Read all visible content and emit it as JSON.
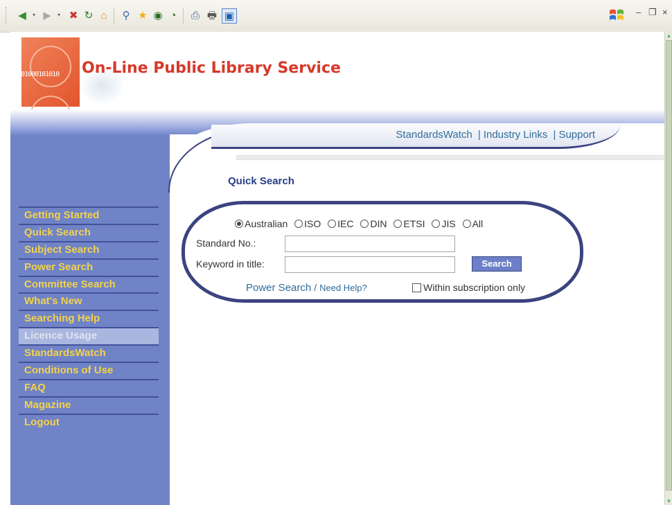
{
  "browser": {
    "toolbar_icons": [
      "back-icon",
      "back-dropdown-icon",
      "forward-icon",
      "forward-dropdown-icon",
      "stop-icon",
      "refresh-icon",
      "home-icon",
      "search-icon",
      "favorites-icon",
      "media-icon",
      "history-icon",
      "print-preview-icon",
      "print-icon",
      "window-icon"
    ]
  },
  "site": {
    "logo_bits": "01000101010",
    "title": "On-Line Public Library Service"
  },
  "top_nav": {
    "items": [
      "StandardsWatch",
      "Industry Links",
      "Support"
    ],
    "separator": "|"
  },
  "quick_search": {
    "heading": "Quick Search",
    "options": [
      {
        "label": "Australian",
        "selected": true
      },
      {
        "label": "ISO",
        "selected": false
      },
      {
        "label": "IEC",
        "selected": false
      },
      {
        "label": "DIN",
        "selected": false
      },
      {
        "label": "ETSI",
        "selected": false
      },
      {
        "label": "JIS",
        "selected": false
      },
      {
        "label": "All",
        "selected": false
      }
    ],
    "standard_no_label": "Standard No.:",
    "standard_no_value": "",
    "keyword_label": "Keyword in title:",
    "keyword_value": "",
    "search_button": "Search",
    "power_search_link": "Power Search",
    "slash": "/",
    "need_help_link": "Need Help?",
    "subscription_checkbox_label": "Within subscription only",
    "subscription_checked": false
  },
  "sidebar": {
    "items": [
      {
        "label": "Getting Started",
        "active": false
      },
      {
        "label": "Quick Search",
        "active": false
      },
      {
        "label": "Subject Search",
        "active": false
      },
      {
        "label": "Power Search",
        "active": false
      },
      {
        "label": "Committee Search",
        "active": false
      },
      {
        "label": "What's New",
        "active": false
      },
      {
        "label": "Searching Help",
        "active": false
      },
      {
        "label": "Licence Usage",
        "active": true
      },
      {
        "label": "StandardsWatch",
        "active": false
      },
      {
        "label": "Conditions of Use",
        "active": false
      },
      {
        "label": "FAQ",
        "active": false
      },
      {
        "label": "Magazine",
        "active": false
      },
      {
        "label": "Logout",
        "active": false
      }
    ]
  },
  "colors": {
    "title_red": "#d8382a",
    "sidebar_blue": "#6f83c6",
    "menu_yellow": "#f3d24d",
    "link_blue": "#2f6c9c",
    "border_navy": "#3b4380"
  }
}
